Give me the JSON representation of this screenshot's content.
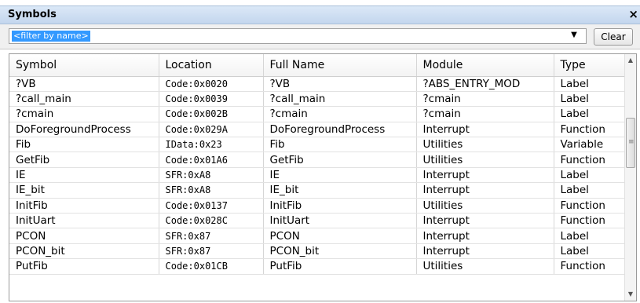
{
  "window": {
    "title": "Symbols",
    "close_symbol": "×"
  },
  "filter": {
    "placeholder": "<filter by name>",
    "dropdown_symbol": "▼",
    "clear_label": "Clear"
  },
  "table": {
    "columns": [
      "Symbol",
      "Location",
      "Full Name",
      "Module",
      "Type"
    ],
    "rows": [
      [
        "?VB",
        "Code:0x0020",
        "?VB",
        "?ABS_ENTRY_MOD",
        "Label"
      ],
      [
        "?call_main",
        "Code:0x0039",
        "?call_main",
        "?cmain",
        "Label"
      ],
      [
        "?cmain",
        "Code:0x002B",
        "?cmain",
        "?cmain",
        "Label"
      ],
      [
        "DoForegroundProcess",
        "Code:0x029A",
        "DoForegroundProcess",
        "Interrupt",
        "Function"
      ],
      [
        "Fib",
        "IData:0x23",
        "Fib",
        "Utilities",
        "Variable"
      ],
      [
        "GetFib",
        "Code:0x01A6",
        "GetFib",
        "Utilities",
        "Function"
      ],
      [
        "IE",
        "SFR:0xA8",
        "IE",
        "Interrupt",
        "Label"
      ],
      [
        "IE_bit",
        "SFR:0xA8",
        "IE_bit",
        "Interrupt",
        "Label"
      ],
      [
        "InitFib",
        "Code:0x0137",
        "InitFib",
        "Utilities",
        "Function"
      ],
      [
        "InitUart",
        "Code:0x028C",
        "InitUart",
        "Interrupt",
        "Function"
      ],
      [
        "PCON",
        "SFR:0x87",
        "PCON",
        "Interrupt",
        "Label"
      ],
      [
        "PCON_bit",
        "SFR:0x87",
        "PCON_bit",
        "Interrupt",
        "Label"
      ],
      [
        "PutFib",
        "Code:0x01CB",
        "PutFib",
        "Utilities",
        "Function"
      ]
    ]
  },
  "scrollbar": {
    "up_symbol": "▲",
    "down_symbol": "▼",
    "grip_symbol": "≡",
    "position": 0.3
  }
}
